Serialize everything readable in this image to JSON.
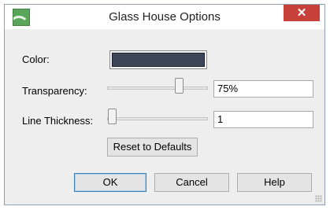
{
  "window": {
    "title": "Glass House Options",
    "close_glyph": "✕"
  },
  "fields": {
    "color_label": "Color:",
    "color_value": "#3e4558",
    "transparency_label": "Transparency:",
    "transparency_value": "75%",
    "transparency_level": 0.75,
    "line_thickness_label": "Line Thickness:",
    "line_thickness_value": "1",
    "line_thickness_level": 0.0
  },
  "buttons": {
    "reset": "Reset to Defaults",
    "ok": "OK",
    "cancel": "Cancel",
    "help": "Help"
  },
  "icons": {
    "app": "glass-house-app-icon",
    "close": "close-icon",
    "resize": "resize-grip-icon"
  }
}
